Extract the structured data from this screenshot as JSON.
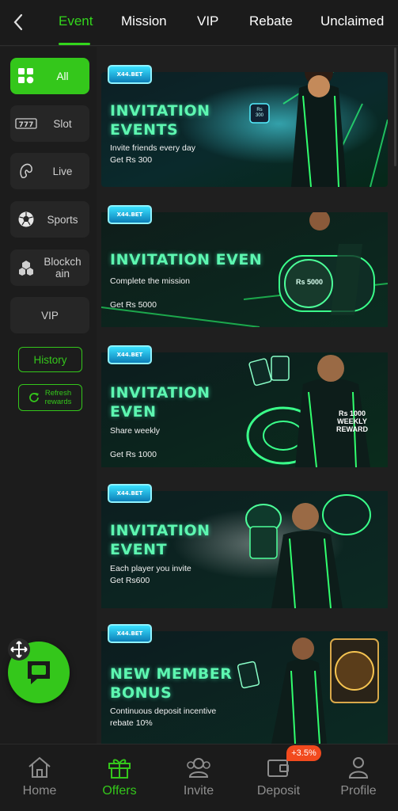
{
  "header": {
    "tabs": [
      {
        "label": "Event",
        "active": true
      },
      {
        "label": "Mission",
        "active": false
      },
      {
        "label": "VIP",
        "active": false
      },
      {
        "label": "Rebate",
        "active": false
      },
      {
        "label": "Unclaimed",
        "active": false
      }
    ],
    "back_icon": "chevron-left-icon"
  },
  "sidebar": {
    "categories": [
      {
        "label": "All",
        "icon": "grid-icon",
        "active": true
      },
      {
        "label": "Slot",
        "icon": "slot-777-icon",
        "active": false
      },
      {
        "label": "Live",
        "icon": "live-dealer-icon",
        "active": false
      },
      {
        "label": "Sports",
        "icon": "soccer-ball-icon",
        "active": false
      },
      {
        "label": "Blockchain",
        "icon": "blockchain-icon",
        "active": false
      },
      {
        "label": "VIP",
        "icon": "",
        "active": false
      }
    ],
    "history_label": "History",
    "refresh_label": "Refresh rewards"
  },
  "banners": [
    {
      "tag": "X44.BET",
      "title": "INVITATION\nEVENTS",
      "subtitle": "Invite friends every day\nGet Rs 300",
      "badge": "Rs\n300"
    },
    {
      "tag": "X44.BET",
      "title": "INVITATION EVEN",
      "subtitle": "Complete the mission\n\nGet Rs 5000",
      "badge": "Rs 5000"
    },
    {
      "tag": "X44.BET",
      "title": "INVITATION\nEVEN",
      "subtitle": "Share weekly\n\nGet Rs 1000",
      "badge": "Rs 1000\nWEEKLY\nREWARD"
    },
    {
      "tag": "X44.BET",
      "title": "INVITATION\nEVENT",
      "subtitle": "Each player you invite\nGet Rs600",
      "badge": ""
    },
    {
      "tag": "X44.BET",
      "title": "NEW MEMBER\nBONUS",
      "subtitle": "Continuous deposit incentive\nrebate 10%",
      "badge": ""
    }
  ],
  "bottom_nav": [
    {
      "label": "Home",
      "icon": "home-icon",
      "active": false
    },
    {
      "label": "Offers",
      "icon": "gift-icon",
      "active": true
    },
    {
      "label": "Invite",
      "icon": "invite-users-icon",
      "active": false
    },
    {
      "label": "Deposit",
      "icon": "wallet-icon",
      "active": false
    },
    {
      "label": "Profile",
      "icon": "profile-icon",
      "active": false
    }
  ],
  "deposit_badge": "+3.5%",
  "colors": {
    "accent": "#34c71b",
    "background": "#1f1f1f",
    "title_glow": "#5df6b0",
    "badge": "#f24a1e"
  }
}
